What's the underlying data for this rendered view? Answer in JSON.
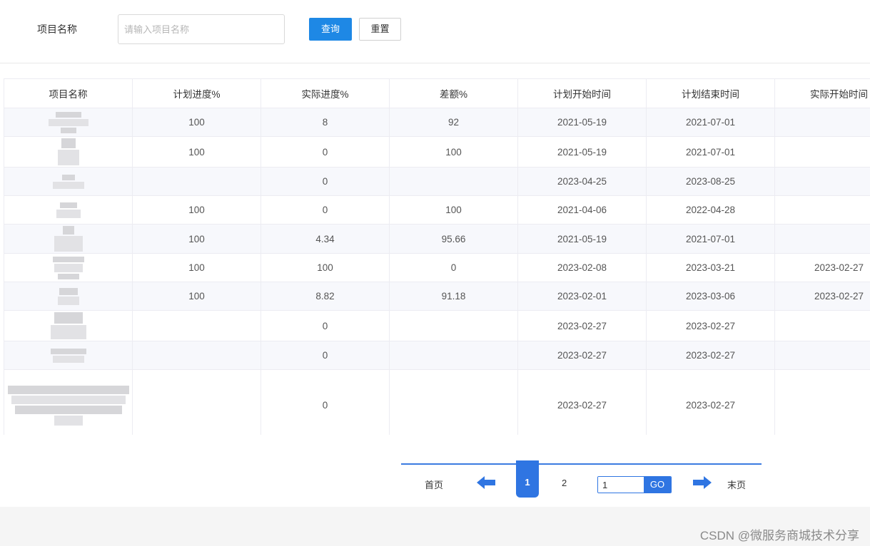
{
  "search": {
    "label": "项目名称",
    "placeholder": "请输入项目名称",
    "value": "",
    "query_label": "查询",
    "reset_label": "重置"
  },
  "table": {
    "headers": [
      "项目名称",
      "计划进度%",
      "实际进度%",
      "差额%",
      "计划开始时间",
      "计划结束时间",
      "实际开始时间"
    ],
    "rows": [
      [
        "",
        "100",
        "8",
        "92",
        "2021-05-19",
        "2021-07-01",
        ""
      ],
      [
        "",
        "100",
        "0",
        "100",
        "2021-05-19",
        "2021-07-01",
        ""
      ],
      [
        "",
        "",
        "0",
        "",
        "2023-04-25",
        "2023-08-25",
        ""
      ],
      [
        "",
        "100",
        "0",
        "100",
        "2021-04-06",
        "2022-04-28",
        ""
      ],
      [
        "",
        "100",
        "4.34",
        "95.66",
        "2021-05-19",
        "2021-07-01",
        ""
      ],
      [
        "",
        "100",
        "100",
        "0",
        "2023-02-08",
        "2023-03-21",
        "2023-02-27"
      ],
      [
        "",
        "100",
        "8.82",
        "91.18",
        "2023-02-01",
        "2023-03-06",
        "2023-02-27"
      ],
      [
        "",
        "",
        "0",
        "",
        "2023-02-27",
        "2023-02-27",
        ""
      ],
      [
        "",
        "",
        "0",
        "",
        "2023-02-27",
        "2023-02-27",
        ""
      ],
      [
        "",
        "",
        "0",
        "",
        "2023-02-27",
        "2023-02-27",
        ""
      ]
    ]
  },
  "pagination": {
    "first_label": "首页",
    "current_page": "1",
    "next_page": "2",
    "jump_value": "1",
    "go_label": "GO",
    "last_label": "末页",
    "accent_color": "#2f75e2"
  },
  "footer": {
    "watermark": "CSDN @微服务商城技术分享"
  }
}
